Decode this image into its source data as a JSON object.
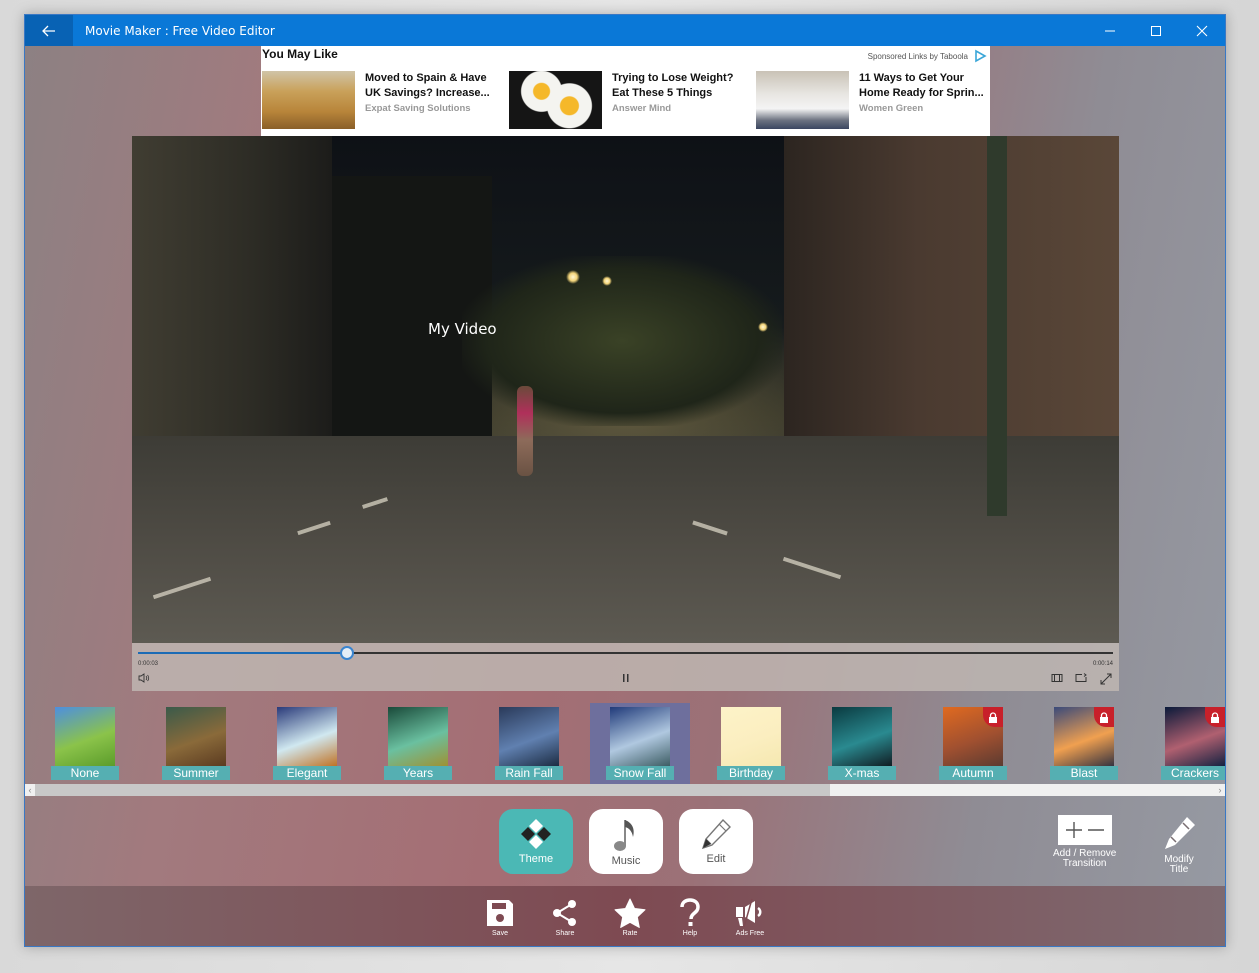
{
  "window": {
    "title": "Movie Maker : Free Video Editor",
    "controls": [
      "minimize",
      "maximize",
      "close"
    ]
  },
  "ad": {
    "heading": "You May Like",
    "sponsor": "Sponsored Links by Taboola",
    "items": [
      {
        "title_line1": "Moved to Spain & Have",
        "title_line2": "UK Savings? Increase...",
        "source": "Expat Saving Solutions"
      },
      {
        "title_line1": "Trying to Lose Weight?",
        "title_line2": "Eat These 5 Things",
        "source": "Answer Mind"
      },
      {
        "title_line1": "11 Ways to Get Your",
        "title_line2": "Home Ready for Sprin...",
        "source": "Women Green"
      }
    ]
  },
  "video": {
    "overlay_title": "My Video"
  },
  "player": {
    "current_time": "0:00:03",
    "total_time": "0:00:14",
    "progress_fraction": 0.214,
    "state": "playing"
  },
  "themes": {
    "selected": "Snow Fall",
    "items": [
      {
        "label": "None",
        "locked": false,
        "colors": [
          "#4d8fe0",
          "#8bc34a",
          "#5a9b2a"
        ]
      },
      {
        "label": "Summer",
        "locked": false,
        "colors": [
          "#3a5a4a",
          "#8a6a3a",
          "#5a3a20"
        ]
      },
      {
        "label": "Elegant",
        "locked": false,
        "colors": [
          "#2a3a7a",
          "#d0e8f0",
          "#c07020"
        ]
      },
      {
        "label": "Years",
        "locked": false,
        "colors": [
          "#1a4a3a",
          "#6ac0a0",
          "#a09030"
        ]
      },
      {
        "label": "Rain Fall",
        "locked": false,
        "colors": [
          "#2a3a5a",
          "#6080b0",
          "#1a2a40"
        ]
      },
      {
        "label": "Snow Fall",
        "locked": false,
        "colors": [
          "#203a7a",
          "#b0c8e0",
          "#3a5a60"
        ]
      },
      {
        "label": "Birthday",
        "locked": false,
        "colors": [
          "#fdf3c8",
          "#fbeec0",
          "#f5e8b0"
        ]
      },
      {
        "label": "X-mas",
        "locked": false,
        "colors": [
          "#0a3a40",
          "#2a8a90",
          "#101a20"
        ]
      },
      {
        "label": "Autumn",
        "locked": true,
        "colors": [
          "#e06a20",
          "#a05030",
          "#5a3a30"
        ]
      },
      {
        "label": "Blast",
        "locked": true,
        "colors": [
          "#3a4a7a",
          "#f0a050",
          "#303040"
        ]
      },
      {
        "label": "Crackers",
        "locked": true,
        "colors": [
          "#0a1a3a",
          "#b06070",
          "#102040"
        ]
      }
    ]
  },
  "modes": [
    {
      "label": "Theme",
      "icon": "theme-icon",
      "active": true
    },
    {
      "label": "Music",
      "icon": "music-note-icon",
      "active": false
    },
    {
      "label": "Edit",
      "icon": "pencil-icon",
      "active": false
    }
  ],
  "side_actions": [
    {
      "label_line1": "Add / Remove",
      "label_line2": "Transition",
      "icon": "add-remove-icon"
    },
    {
      "label_line1": "Modify",
      "label_line2": "Title",
      "icon": "pencil-icon"
    }
  ],
  "bottom_actions": [
    {
      "label": "Save",
      "icon": "save-icon"
    },
    {
      "label": "Share",
      "icon": "share-icon"
    },
    {
      "label": "Rate",
      "icon": "star-icon"
    },
    {
      "label": "Help",
      "icon": "help-icon"
    },
    {
      "label": "Ads Free",
      "icon": "megaphone-icon"
    }
  ],
  "colors": {
    "titlebar": "#0a78d7",
    "accent_teal": "#4bb8b5",
    "theme_label": "#55afb2",
    "selected_theme": "#6e6f9d",
    "lock_badge": "#c8202a",
    "progress": "#1c6bb5"
  }
}
